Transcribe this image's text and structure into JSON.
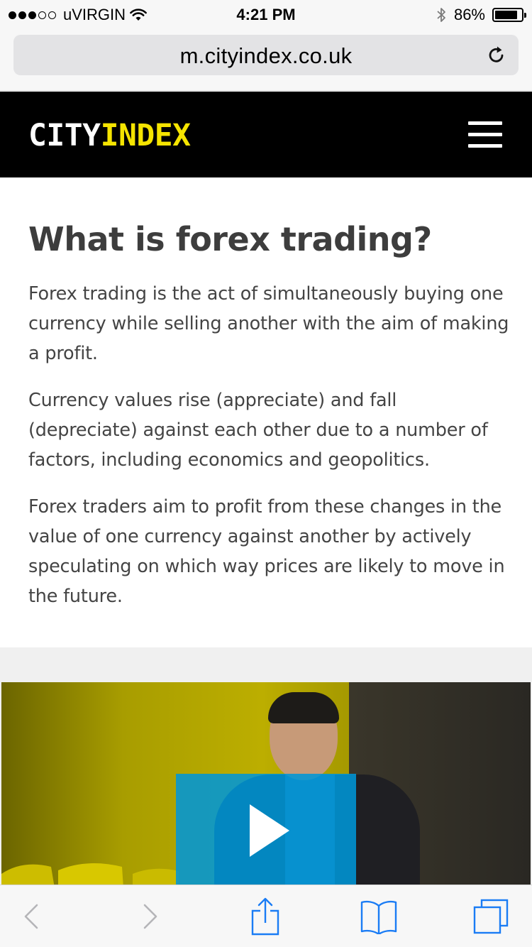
{
  "status_bar": {
    "signal_filled": 3,
    "signal_total": 5,
    "carrier": "uVIRGIN",
    "time": "4:21 PM",
    "battery": "86%",
    "battery_level": 0.86
  },
  "browser": {
    "url": "m.cityindex.co.uk",
    "reload_icon": "reload-icon"
  },
  "header": {
    "logo_city": "CITY",
    "logo_index": "INDEX",
    "menu_icon": "hamburger-menu-icon",
    "logo_accent_color": "#f5e400",
    "background_color": "#000000"
  },
  "article": {
    "title": "What is forex trading?",
    "paragraphs": [
      "Forex trading is the act of simultaneously buying one currency while selling another with the aim of making a profit.",
      "Currency values rise (appreciate) and fall (depreciate) against each other due to a number of factors, including economics and geopolitics.",
      "Forex traders aim to profit from these changes in the value of one currency against another by actively speculating on which way prices are likely to move in the future."
    ]
  },
  "video": {
    "play_icon": "play-icon",
    "play_button_color": "#0096d6"
  },
  "toolbar": {
    "icons": [
      "back-icon",
      "forward-icon",
      "share-icon",
      "bookmarks-icon",
      "tabs-icon"
    ],
    "accent_color": "#1a7cf5"
  }
}
